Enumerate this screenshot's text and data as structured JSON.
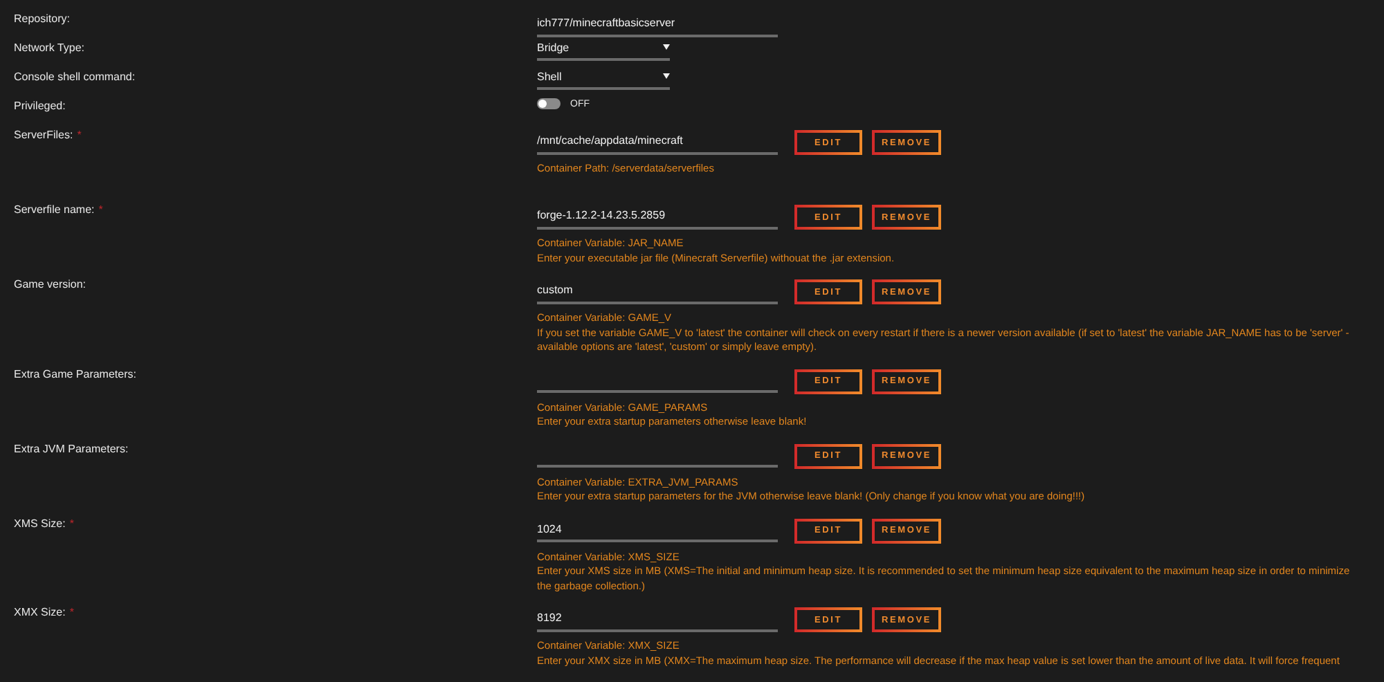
{
  "fields": [
    {
      "kind": "text",
      "label": "Repository:",
      "value": "ich777/minecraftbasicserver"
    },
    {
      "kind": "select",
      "label": "Network Type:",
      "value": "Bridge"
    },
    {
      "kind": "select",
      "label": "Console shell command:",
      "value": "Shell"
    },
    {
      "kind": "switch",
      "label": "Privileged:",
      "on": false,
      "state_label": "OFF"
    },
    {
      "kind": "variable",
      "label": "ServerFiles:",
      "required_mark": "*",
      "value": "/mnt/cache/appdata/minecraft",
      "buttons": [
        "EDIT",
        "REMOVE"
      ],
      "hints": [
        "Container Path: /serverdata/serverfiles"
      ]
    },
    {
      "kind": "variable",
      "label": "Serverfile name:",
      "required_mark": "*",
      "value": "forge-1.12.2-14.23.5.2859",
      "buttons": [
        "EDIT",
        "REMOVE"
      ],
      "hints": [
        "Container Variable: JAR_NAME",
        "Enter your executable jar file (Minecraft Serverfile) withouat the .jar extension."
      ]
    },
    {
      "kind": "variable",
      "label": "Game version:",
      "value": "custom",
      "buttons": [
        "EDIT",
        "REMOVE"
      ],
      "hints": [
        "Container Variable: GAME_V",
        "If you set the variable GAME_V to 'latest' the container will check on every restart if there is a newer version available (if set to 'latest' the variable JAR_NAME has to be 'server' - available options are 'latest', 'custom' or simply leave empty)."
      ]
    },
    {
      "kind": "variable",
      "label": "Extra Game Parameters:",
      "buttons": [
        "EDIT",
        "REMOVE"
      ],
      "hints": [
        "Container Variable: GAME_PARAMS",
        "Enter your extra startup parameters otherwise leave blank!"
      ]
    },
    {
      "kind": "variable",
      "label": "Extra JVM Parameters:",
      "buttons": [
        "EDIT",
        "REMOVE"
      ],
      "hints": [
        "Container Variable: EXTRA_JVM_PARAMS",
        "Enter your extra startup parameters for the JVM otherwise leave blank! (Only change if you know what you are doing!!!)"
      ]
    },
    {
      "kind": "variable",
      "label": "XMS Size:",
      "required_mark": "*",
      "value": "1024",
      "buttons": [
        "EDIT",
        "REMOVE"
      ],
      "hints": [
        "Container Variable: XMS_SIZE",
        "Enter your XMS size in MB (XMS=The initial and minimum heap size. It is recommended to set the minimum heap size equivalent to the maximum heap size in order to minimize the garbage collection.)"
      ]
    },
    {
      "kind": "variable",
      "label": "XMX Size:",
      "required_mark": "*",
      "value": "8192",
      "buttons": [
        "EDIT",
        "REMOVE"
      ],
      "hints": [
        "Container Variable: XMX_SIZE",
        "Enter your XMX size in MB (XMX=The maximum heap size. The performance will decrease if the max heap value is set lower than the amount of live data. It will force frequent"
      ]
    }
  ]
}
